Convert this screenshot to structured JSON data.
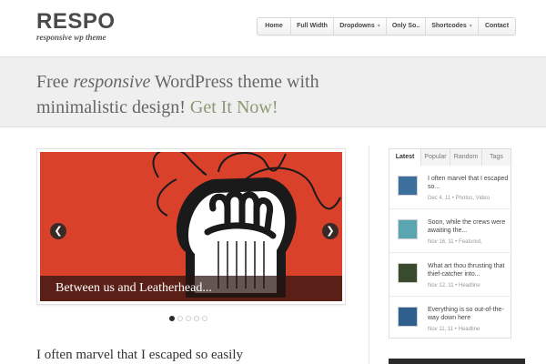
{
  "brand": {
    "name": "RESPO",
    "tagline": "responsive wp theme"
  },
  "nav": [
    {
      "label": "Home",
      "cls": "home",
      "dropdown": false
    },
    {
      "label": "Full Width",
      "cls": "full",
      "dropdown": false
    },
    {
      "label": "Dropdowns",
      "cls": "drop",
      "dropdown": true
    },
    {
      "label": "Only So..",
      "cls": "only",
      "dropdown": false
    },
    {
      "label": "Shortcodes",
      "cls": "short",
      "dropdown": true
    },
    {
      "label": "Contact",
      "cls": "contact",
      "dropdown": false
    }
  ],
  "hero": {
    "part1": "Free ",
    "emphasis": "responsive",
    "part2": " WordPress theme with minimalistic design! ",
    "cta": "Get It Now!"
  },
  "slider": {
    "caption": "Between us and Leatherhead...",
    "prev_icon": "chevron-left-icon",
    "next_icon": "chevron-right-icon",
    "slide_count": 5,
    "active_slide": 1
  },
  "post": {
    "title": "I often marvel that I escaped so easily"
  },
  "sidebar": {
    "tabs": [
      "Latest",
      "Popular",
      "Random",
      "Tags"
    ],
    "active_tab": "Latest",
    "items": [
      {
        "title": "I often marvel that I escaped so...",
        "meta": "Dec 4, 11 • Photos, Video",
        "thumb_color": "#3d6f9e"
      },
      {
        "title": "Soon, while the crews were awaiting the...",
        "meta": "Nov 16, 11 • Featured,",
        "thumb_color": "#5aa5b0"
      },
      {
        "title": "What art thou thrusting that thief-catcher into...",
        "meta": "Nov 12, 11 • Headline",
        "thumb_color": "#3a4a2c"
      },
      {
        "title": "Everything is so out-of-the-way down here",
        "meta": "Nov 11, 11 • Headline",
        "thumb_color": "#2f5f8f"
      }
    ]
  },
  "colors": {
    "accent": "#8a9a74",
    "slide_background": "#d9412b",
    "hero_band": "#efefef"
  }
}
